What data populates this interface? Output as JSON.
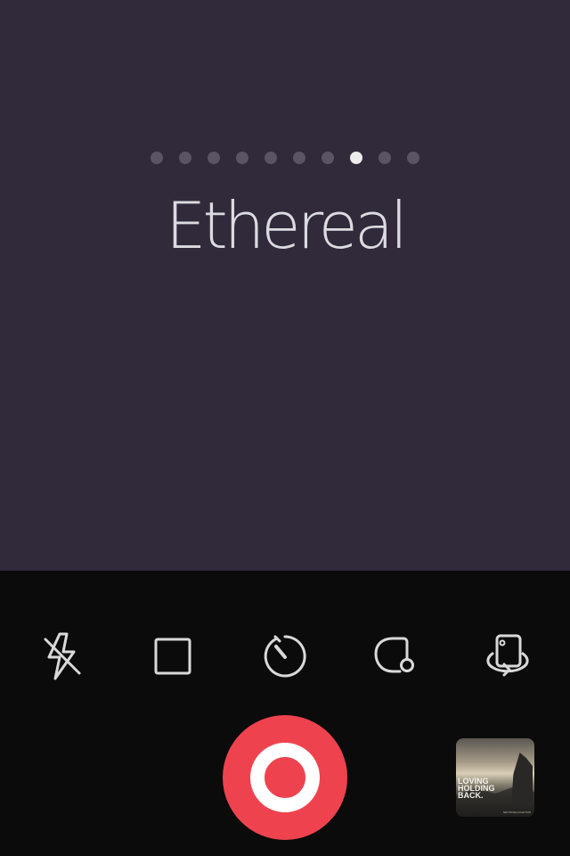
{
  "filter": {
    "name": "Ethereal",
    "dot_count": 10,
    "active_index": 7
  },
  "toolbar": {
    "items": [
      {
        "icon": "flash-off-icon"
      },
      {
        "icon": "square-crop-icon"
      },
      {
        "icon": "timer-icon"
      },
      {
        "icon": "vignette-icon"
      },
      {
        "icon": "switch-camera-icon"
      }
    ]
  },
  "shutter": {
    "color": "#ee434f"
  },
  "thumbnail": {
    "quote_lines": [
      "LOVING",
      "HOLDING",
      "BACK."
    ],
    "caption": "SETTINGLOCATION"
  },
  "colors": {
    "viewfinder": "#312a3b",
    "controls": "#0b0b0b",
    "shutter": "#ee434f",
    "dot_inactive": "#5a5464",
    "dot_active": "#ececec"
  }
}
